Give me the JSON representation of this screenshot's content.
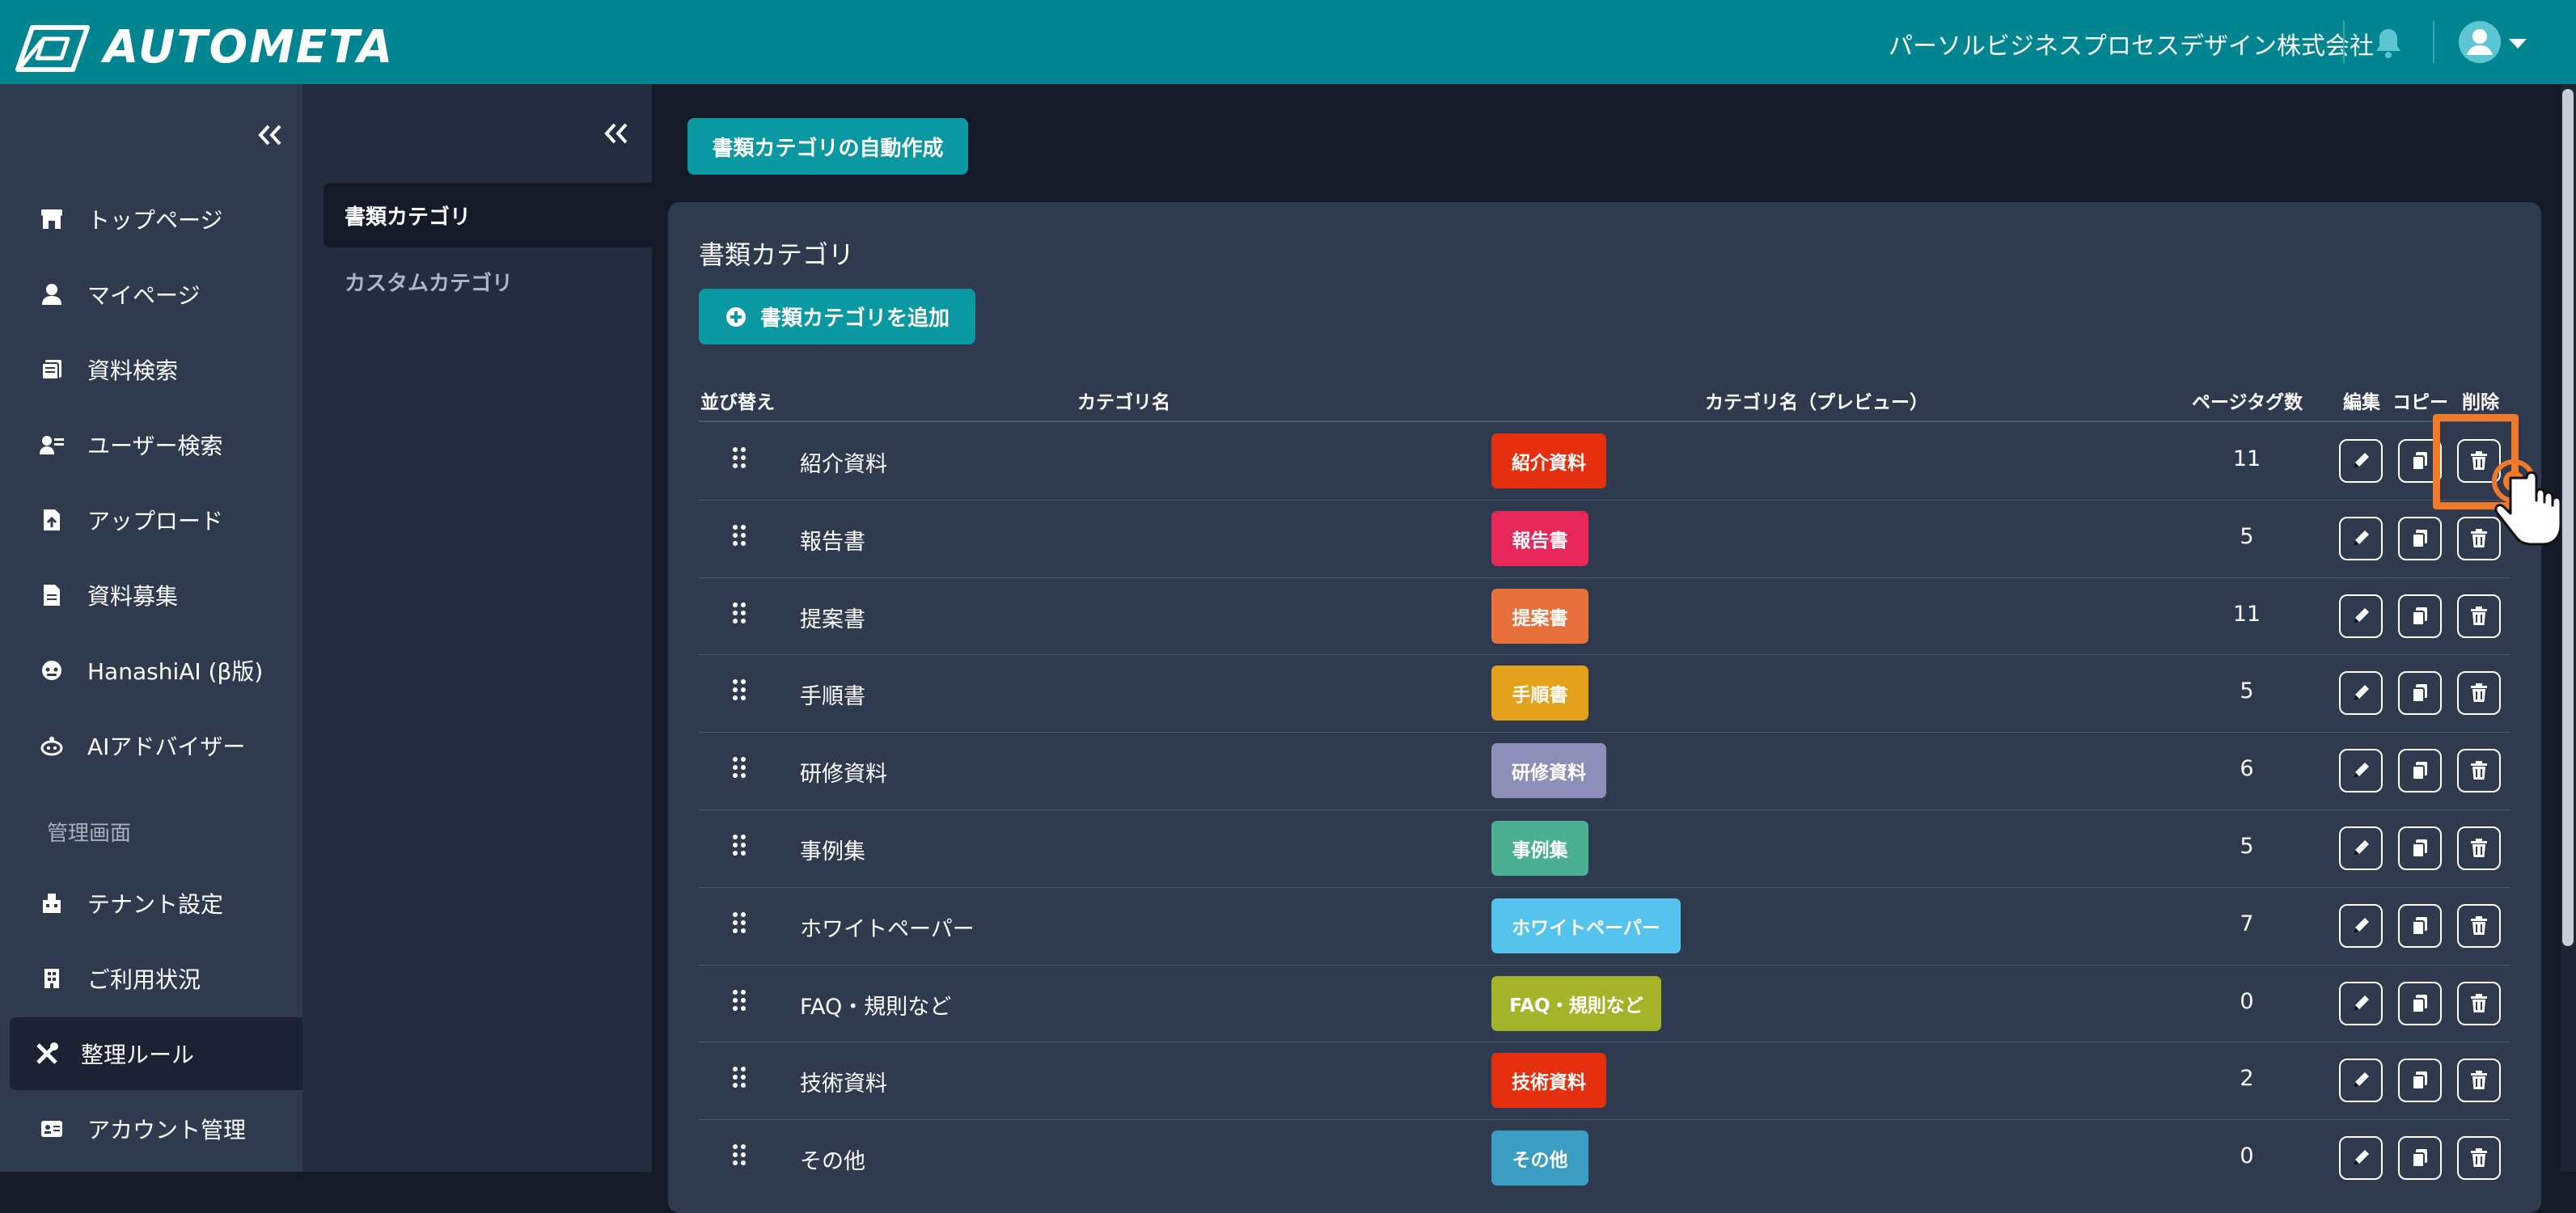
{
  "header": {
    "logo_text": "AUTOMETA",
    "company": "パーソルビジネスプロセスデザイン株式会社",
    "bg_color": "#018691"
  },
  "sidebar": {
    "items": [
      {
        "label": "トップページ",
        "icon": "store-icon"
      },
      {
        "label": "マイページ",
        "icon": "person-icon"
      },
      {
        "label": "資料検索",
        "icon": "document-search-icon"
      },
      {
        "label": "ユーザー検索",
        "icon": "user-search-icon"
      },
      {
        "label": "アップロード",
        "icon": "file-upload-icon"
      },
      {
        "label": "資料募集",
        "icon": "file-icon"
      },
      {
        "label": "HanashiAI (β版)",
        "icon": "chat-bot-icon"
      },
      {
        "label": "AIアドバイザー",
        "icon": "robot-icon"
      }
    ],
    "section_title": "管理画面",
    "admin_items": [
      {
        "label": "テナント設定",
        "icon": "building-icon"
      },
      {
        "label": "ご利用状況",
        "icon": "office-icon"
      },
      {
        "label": "整理ルール",
        "icon": "tools-icon",
        "active": true
      },
      {
        "label": "アカウント管理",
        "icon": "id-card-icon"
      }
    ]
  },
  "subnav": {
    "items": [
      {
        "label": "書類カテゴリ",
        "active": true
      },
      {
        "label": "カスタムカテゴリ",
        "active": false
      }
    ]
  },
  "main": {
    "auto_create_button": "書類カテゴリの自動作成",
    "panel_title": "書類カテゴリ",
    "add_button": "書類カテゴリを追加",
    "columns": {
      "sort": "並び替え",
      "name": "カテゴリ名",
      "preview": "カテゴリ名（プレビュー）",
      "page_tags": "ページタグ数",
      "edit": "編集",
      "copy": "コピー",
      "delete": "削除"
    },
    "rows": [
      {
        "name": "紹介資料",
        "tag": "紹介資料",
        "color": "#e4300f",
        "count": "11"
      },
      {
        "name": "報告書",
        "tag": "報告書",
        "color": "#e8275a",
        "count": "5"
      },
      {
        "name": "提案書",
        "tag": "提案書",
        "color": "#e8703c",
        "count": "11"
      },
      {
        "name": "手順書",
        "tag": "手順書",
        "color": "#e4a11b",
        "count": "5"
      },
      {
        "name": "研修資料",
        "tag": "研修資料",
        "color": "#8e8fb8",
        "count": "6"
      },
      {
        "name": "事例集",
        "tag": "事例集",
        "color": "#4baf91",
        "count": "5"
      },
      {
        "name": "ホワイトペーパー",
        "tag": "ホワイトペーパー",
        "color": "#55c3ec",
        "count": "7"
      },
      {
        "name": "FAQ・規則など",
        "tag": "FAQ・規則など",
        "color": "#a3b32a",
        "count": "0"
      },
      {
        "name": "技術資料",
        "tag": "技術資料",
        "color": "#e4300f",
        "count": "2"
      },
      {
        "name": "その他",
        "tag": "その他",
        "color": "#3b9dc2",
        "count": "0"
      }
    ]
  }
}
